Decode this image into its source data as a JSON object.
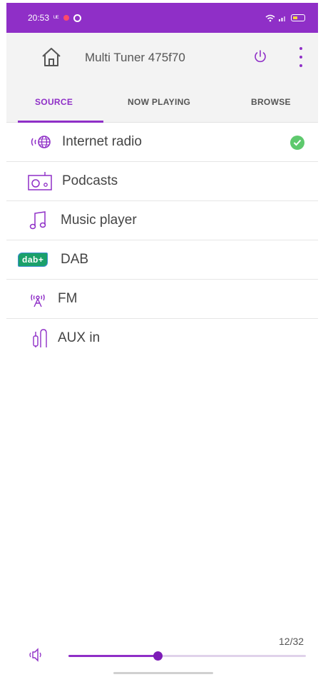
{
  "status_bar": {
    "time": "20:53",
    "carrier": "ᵁᴱ"
  },
  "app_bar": {
    "title": "Multi Tuner 475f70"
  },
  "tabs": [
    {
      "label": "SOURCE",
      "active": true
    },
    {
      "label": "NOW PLAYING",
      "active": false
    },
    {
      "label": "BROWSE",
      "active": false
    }
  ],
  "sources": [
    {
      "label": "Internet radio",
      "icon": "internet-radio-icon",
      "selected": true
    },
    {
      "label": "Podcasts",
      "icon": "podcasts-icon",
      "selected": false
    },
    {
      "label": "Music player",
      "icon": "music-note-icon",
      "selected": false
    },
    {
      "label": "DAB",
      "icon": "dab-plus-icon",
      "icon_text": "dab+",
      "selected": false
    },
    {
      "label": "FM",
      "icon": "fm-antenna-icon",
      "selected": false
    },
    {
      "label": "AUX in",
      "icon": "aux-cable-icon",
      "selected": false
    }
  ],
  "volume": {
    "readout": "12/32",
    "level": 12,
    "max": 32
  },
  "colors": {
    "accent": "#8f2fc7",
    "check": "#5ec96d",
    "status_bar": "#8f2fc7"
  }
}
